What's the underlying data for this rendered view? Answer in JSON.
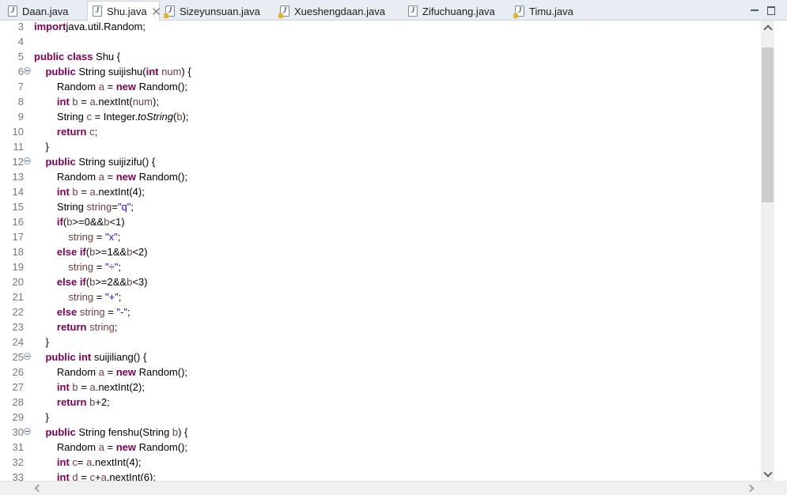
{
  "tabs": [
    {
      "label": "Daan.java",
      "active": false,
      "warning": false
    },
    {
      "label": "Shu.java",
      "active": true,
      "warning": false
    },
    {
      "label": "Sizeyunsuan.java",
      "active": false,
      "warning": true
    },
    {
      "label": "Xueshengdaan.java",
      "active": false,
      "warning": true
    },
    {
      "label": "Zifuchuang.java",
      "active": false,
      "warning": false
    },
    {
      "label": "Timu.java",
      "active": false,
      "warning": true
    }
  ],
  "icons": {
    "file": "java-file-icon",
    "close": "close-icon",
    "minimize": "minimize-icon",
    "maximize": "maximize-icon"
  },
  "colors": {
    "keyword": "#7f0055",
    "string": "#2a00ff",
    "variable": "#6a3e3e",
    "line_number": "#787878"
  },
  "lines": [
    {
      "n": "3",
      "fold": false,
      "tokens": [
        [
          "kw",
          "import"
        ],
        [
          "",
          "java.util.Random;"
        ]
      ]
    },
    {
      "n": "4",
      "fold": false,
      "tokens": []
    },
    {
      "n": "5",
      "fold": false,
      "tokens": [
        [
          "kw",
          "public class"
        ],
        [
          "",
          " Shu {"
        ]
      ]
    },
    {
      "n": "6",
      "fold": true,
      "tokens": [
        [
          "",
          "    "
        ],
        [
          "kw",
          "public"
        ],
        [
          "",
          " String suijishu("
        ],
        [
          "kw",
          "int"
        ],
        [
          "",
          " "
        ],
        [
          "var",
          "num"
        ],
        [
          "",
          ") {"
        ]
      ]
    },
    {
      "n": "7",
      "fold": false,
      "tokens": [
        [
          "",
          "        Random "
        ],
        [
          "var",
          "a"
        ],
        [
          "",
          " = "
        ],
        [
          "kw",
          "new"
        ],
        [
          "",
          " Random();"
        ]
      ]
    },
    {
      "n": "8",
      "fold": false,
      "tokens": [
        [
          "",
          "        "
        ],
        [
          "kw",
          "int"
        ],
        [
          "",
          " "
        ],
        [
          "var",
          "b"
        ],
        [
          "",
          " = "
        ],
        [
          "var",
          "a"
        ],
        [
          "",
          ".nextInt("
        ],
        [
          "var",
          "num"
        ],
        [
          "",
          ");"
        ]
      ]
    },
    {
      "n": "9",
      "fold": false,
      "tokens": [
        [
          "",
          "        String "
        ],
        [
          "var",
          "c"
        ],
        [
          "",
          " = Integer."
        ],
        [
          "it",
          "toString"
        ],
        [
          "",
          "("
        ],
        [
          "var",
          "b"
        ],
        [
          "",
          ");"
        ]
      ]
    },
    {
      "n": "10",
      "fold": false,
      "tokens": [
        [
          "",
          "        "
        ],
        [
          "kw",
          "return"
        ],
        [
          "",
          " "
        ],
        [
          "var",
          "c"
        ],
        [
          "",
          ";"
        ]
      ]
    },
    {
      "n": "11",
      "fold": false,
      "tokens": [
        [
          "",
          "    }"
        ]
      ]
    },
    {
      "n": "12",
      "fold": true,
      "tokens": [
        [
          "",
          "    "
        ],
        [
          "kw",
          "public"
        ],
        [
          "",
          " String suijizifu() {"
        ]
      ]
    },
    {
      "n": "13",
      "fold": false,
      "tokens": [
        [
          "",
          "        Random "
        ],
        [
          "var",
          "a"
        ],
        [
          "",
          " = "
        ],
        [
          "kw",
          "new"
        ],
        [
          "",
          " Random();"
        ]
      ]
    },
    {
      "n": "14",
      "fold": false,
      "tokens": [
        [
          "",
          "        "
        ],
        [
          "kw",
          "int"
        ],
        [
          "",
          " "
        ],
        [
          "var",
          "b"
        ],
        [
          "",
          " = "
        ],
        [
          "var",
          "a"
        ],
        [
          "",
          ".nextInt(4);"
        ]
      ]
    },
    {
      "n": "15",
      "fold": false,
      "tokens": [
        [
          "",
          "        String "
        ],
        [
          "var",
          "string"
        ],
        [
          "",
          "="
        ],
        [
          "str",
          "\"q\""
        ],
        [
          "",
          ";"
        ]
      ]
    },
    {
      "n": "16",
      "fold": false,
      "tokens": [
        [
          "",
          "        "
        ],
        [
          "kw",
          "if"
        ],
        [
          "",
          "("
        ],
        [
          "var",
          "b"
        ],
        [
          "",
          ">=0&&"
        ],
        [
          "var",
          "b"
        ],
        [
          "",
          "<1)"
        ]
      ]
    },
    {
      "n": "17",
      "fold": false,
      "tokens": [
        [
          "",
          "            "
        ],
        [
          "var",
          "string"
        ],
        [
          "",
          " = "
        ],
        [
          "str",
          "\"x\""
        ],
        [
          "",
          ";"
        ]
      ]
    },
    {
      "n": "18",
      "fold": false,
      "tokens": [
        [
          "",
          "        "
        ],
        [
          "kw",
          "else if"
        ],
        [
          "",
          "("
        ],
        [
          "var",
          "b"
        ],
        [
          "",
          ">=1&&"
        ],
        [
          "var",
          "b"
        ],
        [
          "",
          "<2)"
        ]
      ]
    },
    {
      "n": "19",
      "fold": false,
      "tokens": [
        [
          "",
          "            "
        ],
        [
          "var",
          "string"
        ],
        [
          "",
          " = "
        ],
        [
          "str",
          "\"÷\""
        ],
        [
          "",
          ";"
        ]
      ]
    },
    {
      "n": "20",
      "fold": false,
      "tokens": [
        [
          "",
          "        "
        ],
        [
          "kw",
          "else if"
        ],
        [
          "",
          "("
        ],
        [
          "var",
          "b"
        ],
        [
          "",
          ">=2&&"
        ],
        [
          "var",
          "b"
        ],
        [
          "",
          "<3)"
        ]
      ]
    },
    {
      "n": "21",
      "fold": false,
      "tokens": [
        [
          "",
          "            "
        ],
        [
          "var",
          "string"
        ],
        [
          "",
          " = "
        ],
        [
          "str",
          "\"+\""
        ],
        [
          "",
          ";"
        ]
      ]
    },
    {
      "n": "22",
      "fold": false,
      "tokens": [
        [
          "",
          "        "
        ],
        [
          "kw",
          "else"
        ],
        [
          "",
          " "
        ],
        [
          "var",
          "string"
        ],
        [
          "",
          " = "
        ],
        [
          "str",
          "\"-\""
        ],
        [
          "",
          ";"
        ]
      ]
    },
    {
      "n": "23",
      "fold": false,
      "tokens": [
        [
          "",
          "        "
        ],
        [
          "kw",
          "return"
        ],
        [
          "",
          " "
        ],
        [
          "var",
          "string"
        ],
        [
          "",
          ";"
        ]
      ]
    },
    {
      "n": "24",
      "fold": false,
      "tokens": [
        [
          "",
          "    }"
        ]
      ]
    },
    {
      "n": "25",
      "fold": true,
      "tokens": [
        [
          "",
          "    "
        ],
        [
          "kw",
          "public int"
        ],
        [
          "",
          " suijiliang() {"
        ]
      ]
    },
    {
      "n": "26",
      "fold": false,
      "tokens": [
        [
          "",
          "        Random "
        ],
        [
          "var",
          "a"
        ],
        [
          "",
          " = "
        ],
        [
          "kw",
          "new"
        ],
        [
          "",
          " Random();"
        ]
      ]
    },
    {
      "n": "27",
      "fold": false,
      "tokens": [
        [
          "",
          "        "
        ],
        [
          "kw",
          "int"
        ],
        [
          "",
          " "
        ],
        [
          "var",
          "b"
        ],
        [
          "",
          " = "
        ],
        [
          "var",
          "a"
        ],
        [
          "",
          ".nextInt(2);"
        ]
      ]
    },
    {
      "n": "28",
      "fold": false,
      "tokens": [
        [
          "",
          "        "
        ],
        [
          "kw",
          "return"
        ],
        [
          "",
          " "
        ],
        [
          "var",
          "b"
        ],
        [
          "",
          "+2;"
        ]
      ]
    },
    {
      "n": "29",
      "fold": false,
      "tokens": [
        [
          "",
          "    }"
        ]
      ]
    },
    {
      "n": "30",
      "fold": true,
      "tokens": [
        [
          "",
          "    "
        ],
        [
          "kw",
          "public"
        ],
        [
          "",
          " String fenshu(String "
        ],
        [
          "var",
          "b"
        ],
        [
          "",
          ") {"
        ]
      ]
    },
    {
      "n": "31",
      "fold": false,
      "tokens": [
        [
          "",
          "        Random "
        ],
        [
          "var",
          "a"
        ],
        [
          "",
          " = "
        ],
        [
          "kw",
          "new"
        ],
        [
          "",
          " Random();"
        ]
      ]
    },
    {
      "n": "32",
      "fold": false,
      "tokens": [
        [
          "",
          "        "
        ],
        [
          "kw",
          "int"
        ],
        [
          "",
          " "
        ],
        [
          "var",
          "c"
        ],
        [
          "",
          "= "
        ],
        [
          "var",
          "a"
        ],
        [
          "",
          ".nextInt(4);"
        ]
      ]
    },
    {
      "n": "33",
      "fold": false,
      "tokens": [
        [
          "",
          "        "
        ],
        [
          "kw",
          "int"
        ],
        [
          "",
          " "
        ],
        [
          "var",
          "d"
        ],
        [
          "",
          " = "
        ],
        [
          "var",
          "c"
        ],
        [
          "",
          "+"
        ],
        [
          "var",
          "a"
        ],
        [
          "",
          ".nextInt(6);"
        ]
      ]
    }
  ]
}
